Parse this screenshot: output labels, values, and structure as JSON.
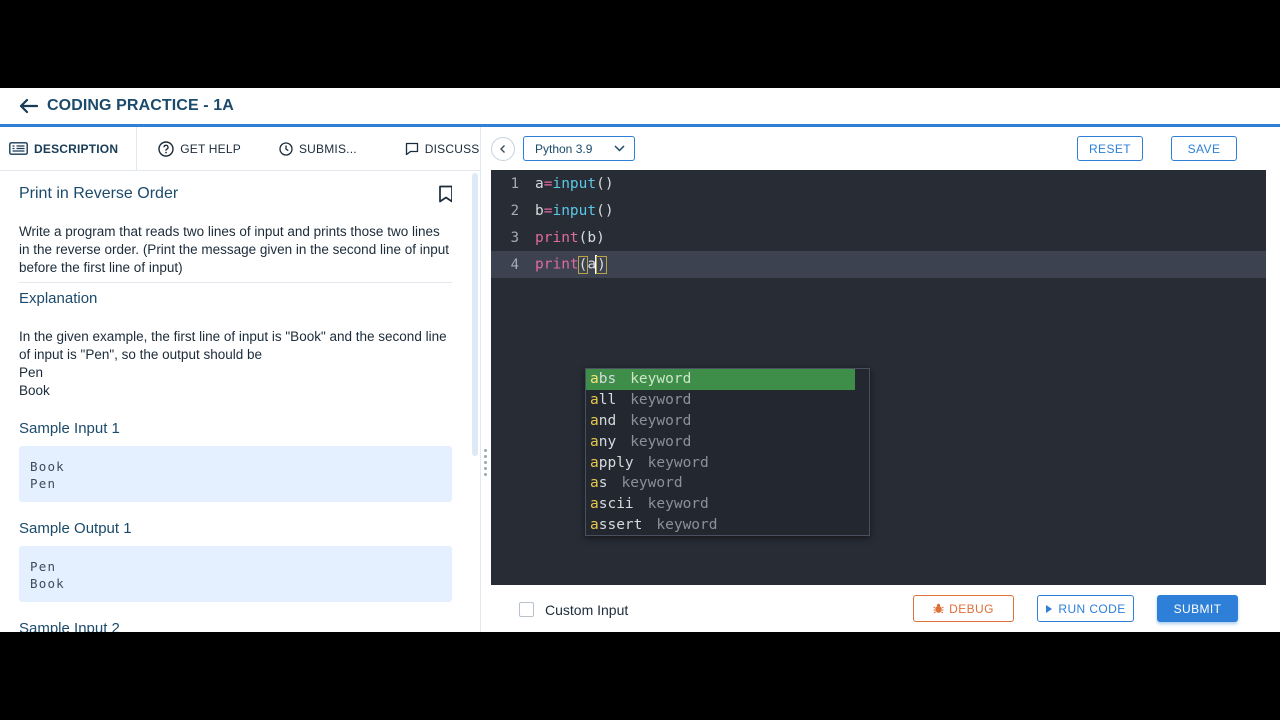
{
  "header": {
    "title": "CODING PRACTICE - 1A"
  },
  "tabs": [
    {
      "label": "DESCRIPTION",
      "icon": "description-icon",
      "active": true
    },
    {
      "label": "GET HELP",
      "icon": "help-circle-icon"
    },
    {
      "label": "SUBMIS...",
      "icon": "clock-icon"
    },
    {
      "label": "DISCUSS",
      "icon": "chat-icon"
    }
  ],
  "question": {
    "title": "Print in Reverse Order",
    "description": "Write a program that reads two lines of input and prints those two lines in the reverse order. (Print the message given in the second line of input before the first line of input)",
    "explanation_title": "Explanation",
    "explanation": "In the given example, the first line of input is \"Book\" and the second line of input is \"Pen\", so the output should be",
    "explanation_out1": "Pen",
    "explanation_out2": "Book",
    "sample_input_1_title": "Sample Input 1",
    "sample_input_1": [
      "Book",
      "Pen"
    ],
    "sample_output_1_title": "Sample Output 1",
    "sample_output_1": [
      "Pen",
      "Book"
    ],
    "sample_input_2_title": "Sample Input 2"
  },
  "editor": {
    "language": "Python 3.9",
    "reset_label": "RESET",
    "save_label": "SAVE",
    "lines": [
      {
        "n": "1",
        "text": "a=input()"
      },
      {
        "n": "2",
        "text": "b=input()"
      },
      {
        "n": "3",
        "text": "print(b)"
      },
      {
        "n": "4",
        "text": "print(a)"
      }
    ],
    "autocomplete": {
      "typed": "a",
      "items": [
        {
          "rest": "bs",
          "kind": "keyword"
        },
        {
          "rest": "ll",
          "kind": "keyword"
        },
        {
          "rest": "nd",
          "kind": "keyword"
        },
        {
          "rest": "ny",
          "kind": "keyword"
        },
        {
          "rest": "pply",
          "kind": "keyword"
        },
        {
          "rest": "s",
          "kind": "keyword"
        },
        {
          "rest": "scii",
          "kind": "keyword"
        },
        {
          "rest": "ssert",
          "kind": "keyword"
        }
      ]
    }
  },
  "bottom": {
    "custom_input_label": "Custom Input",
    "debug_label": "DEBUG",
    "run_label": "RUN CODE",
    "submit_label": "SUBMIT"
  },
  "colors": {
    "accent": "#2d7fd8",
    "editor_bg": "#272c35",
    "debug": "#e0703a",
    "selection": "#3e8e4a"
  }
}
